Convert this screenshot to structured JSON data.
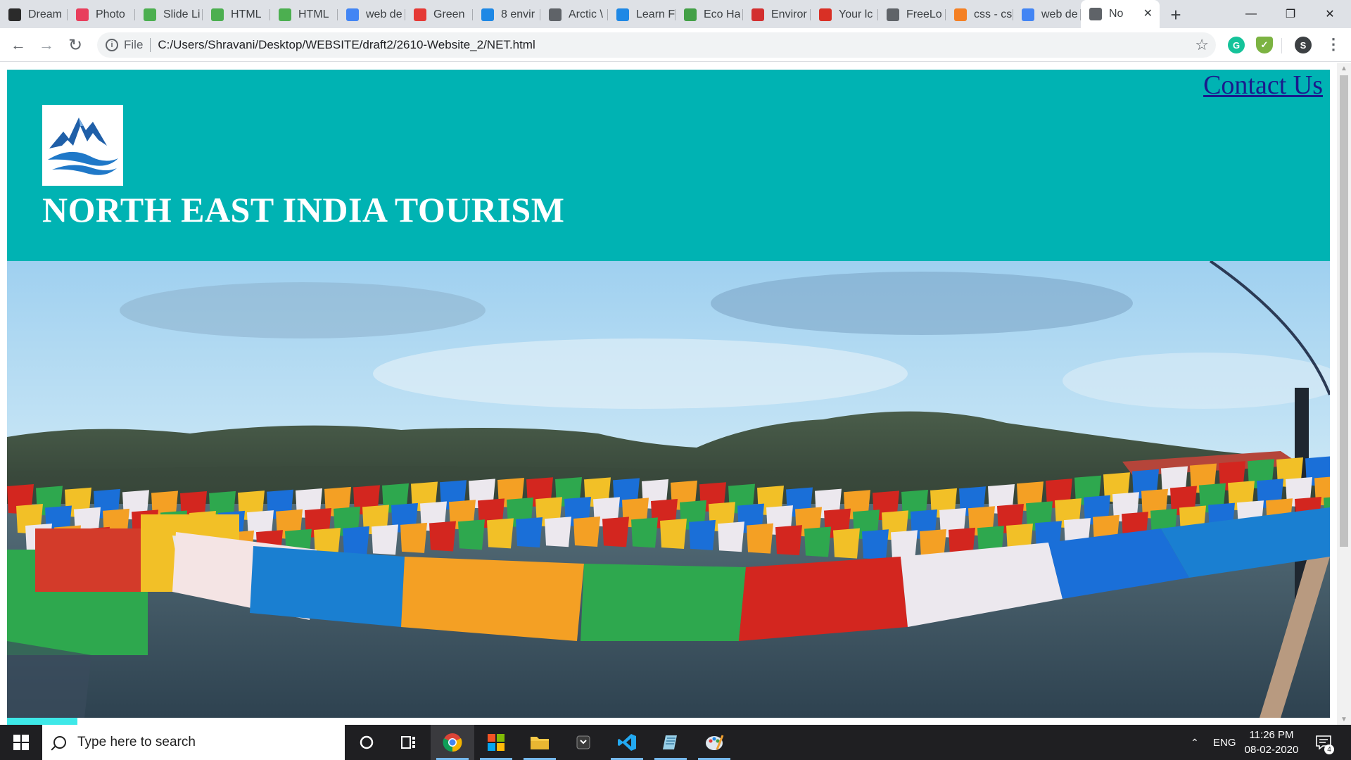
{
  "browser": {
    "tabs": [
      {
        "label": "Dream",
        "icon": "dreamstime-icon",
        "color": "#2b2b2b"
      },
      {
        "label": "Photo",
        "icon": "photo-icon",
        "color": "#e83e5c"
      },
      {
        "label": "Slide Li",
        "icon": "slide-icon",
        "color": "#4caf50"
      },
      {
        "label": "HTML",
        "icon": "html-icon",
        "color": "#4caf50"
      },
      {
        "label": "HTML",
        "icon": "w3-icon",
        "color": "#4caf50"
      },
      {
        "label": "web de",
        "icon": "google-icon",
        "color": "#4285f4"
      },
      {
        "label": "Green",
        "icon": "green-icon",
        "color": "#e53935"
      },
      {
        "label": "8 envir",
        "icon": "grid-icon",
        "color": "#1e88e5"
      },
      {
        "label": "Arctic \\",
        "icon": "globe-icon",
        "color": "#5f6368"
      },
      {
        "label": "Learn F",
        "icon": "grid-icon",
        "color": "#1e88e5"
      },
      {
        "label": "Eco Ha",
        "icon": "eco-icon",
        "color": "#43a047"
      },
      {
        "label": "Enviror",
        "icon": "environment-icon",
        "color": "#d32f2f"
      },
      {
        "label": "Your lc",
        "icon": "gmail-icon",
        "color": "#d93025"
      },
      {
        "label": "FreeLo",
        "icon": "globe-icon",
        "color": "#5f6368"
      },
      {
        "label": "css - cs",
        "icon": "stackoverflow-icon",
        "color": "#f48024"
      },
      {
        "label": "web de",
        "icon": "google-icon",
        "color": "#4285f4"
      },
      {
        "label": "No",
        "icon": "globe-icon",
        "color": "#5f6368",
        "active": true
      }
    ],
    "new_tab": "+",
    "close_tab": "✕",
    "address": {
      "scheme": "File",
      "url": "C:/Users/Shravani/Desktop/WEBSITE/draft2/2610-Website_2/NET.html"
    },
    "profile_initial": "S"
  },
  "page": {
    "title": "NORTH EAST INDIA TOURISM",
    "contact_link": "Contact Us",
    "brand_color": "#00b3b3"
  },
  "taskbar": {
    "search_placeholder": "Type here to search",
    "language": "ENG",
    "time": "11:26 PM",
    "date": "08-02-2020",
    "notification_count": "4"
  }
}
